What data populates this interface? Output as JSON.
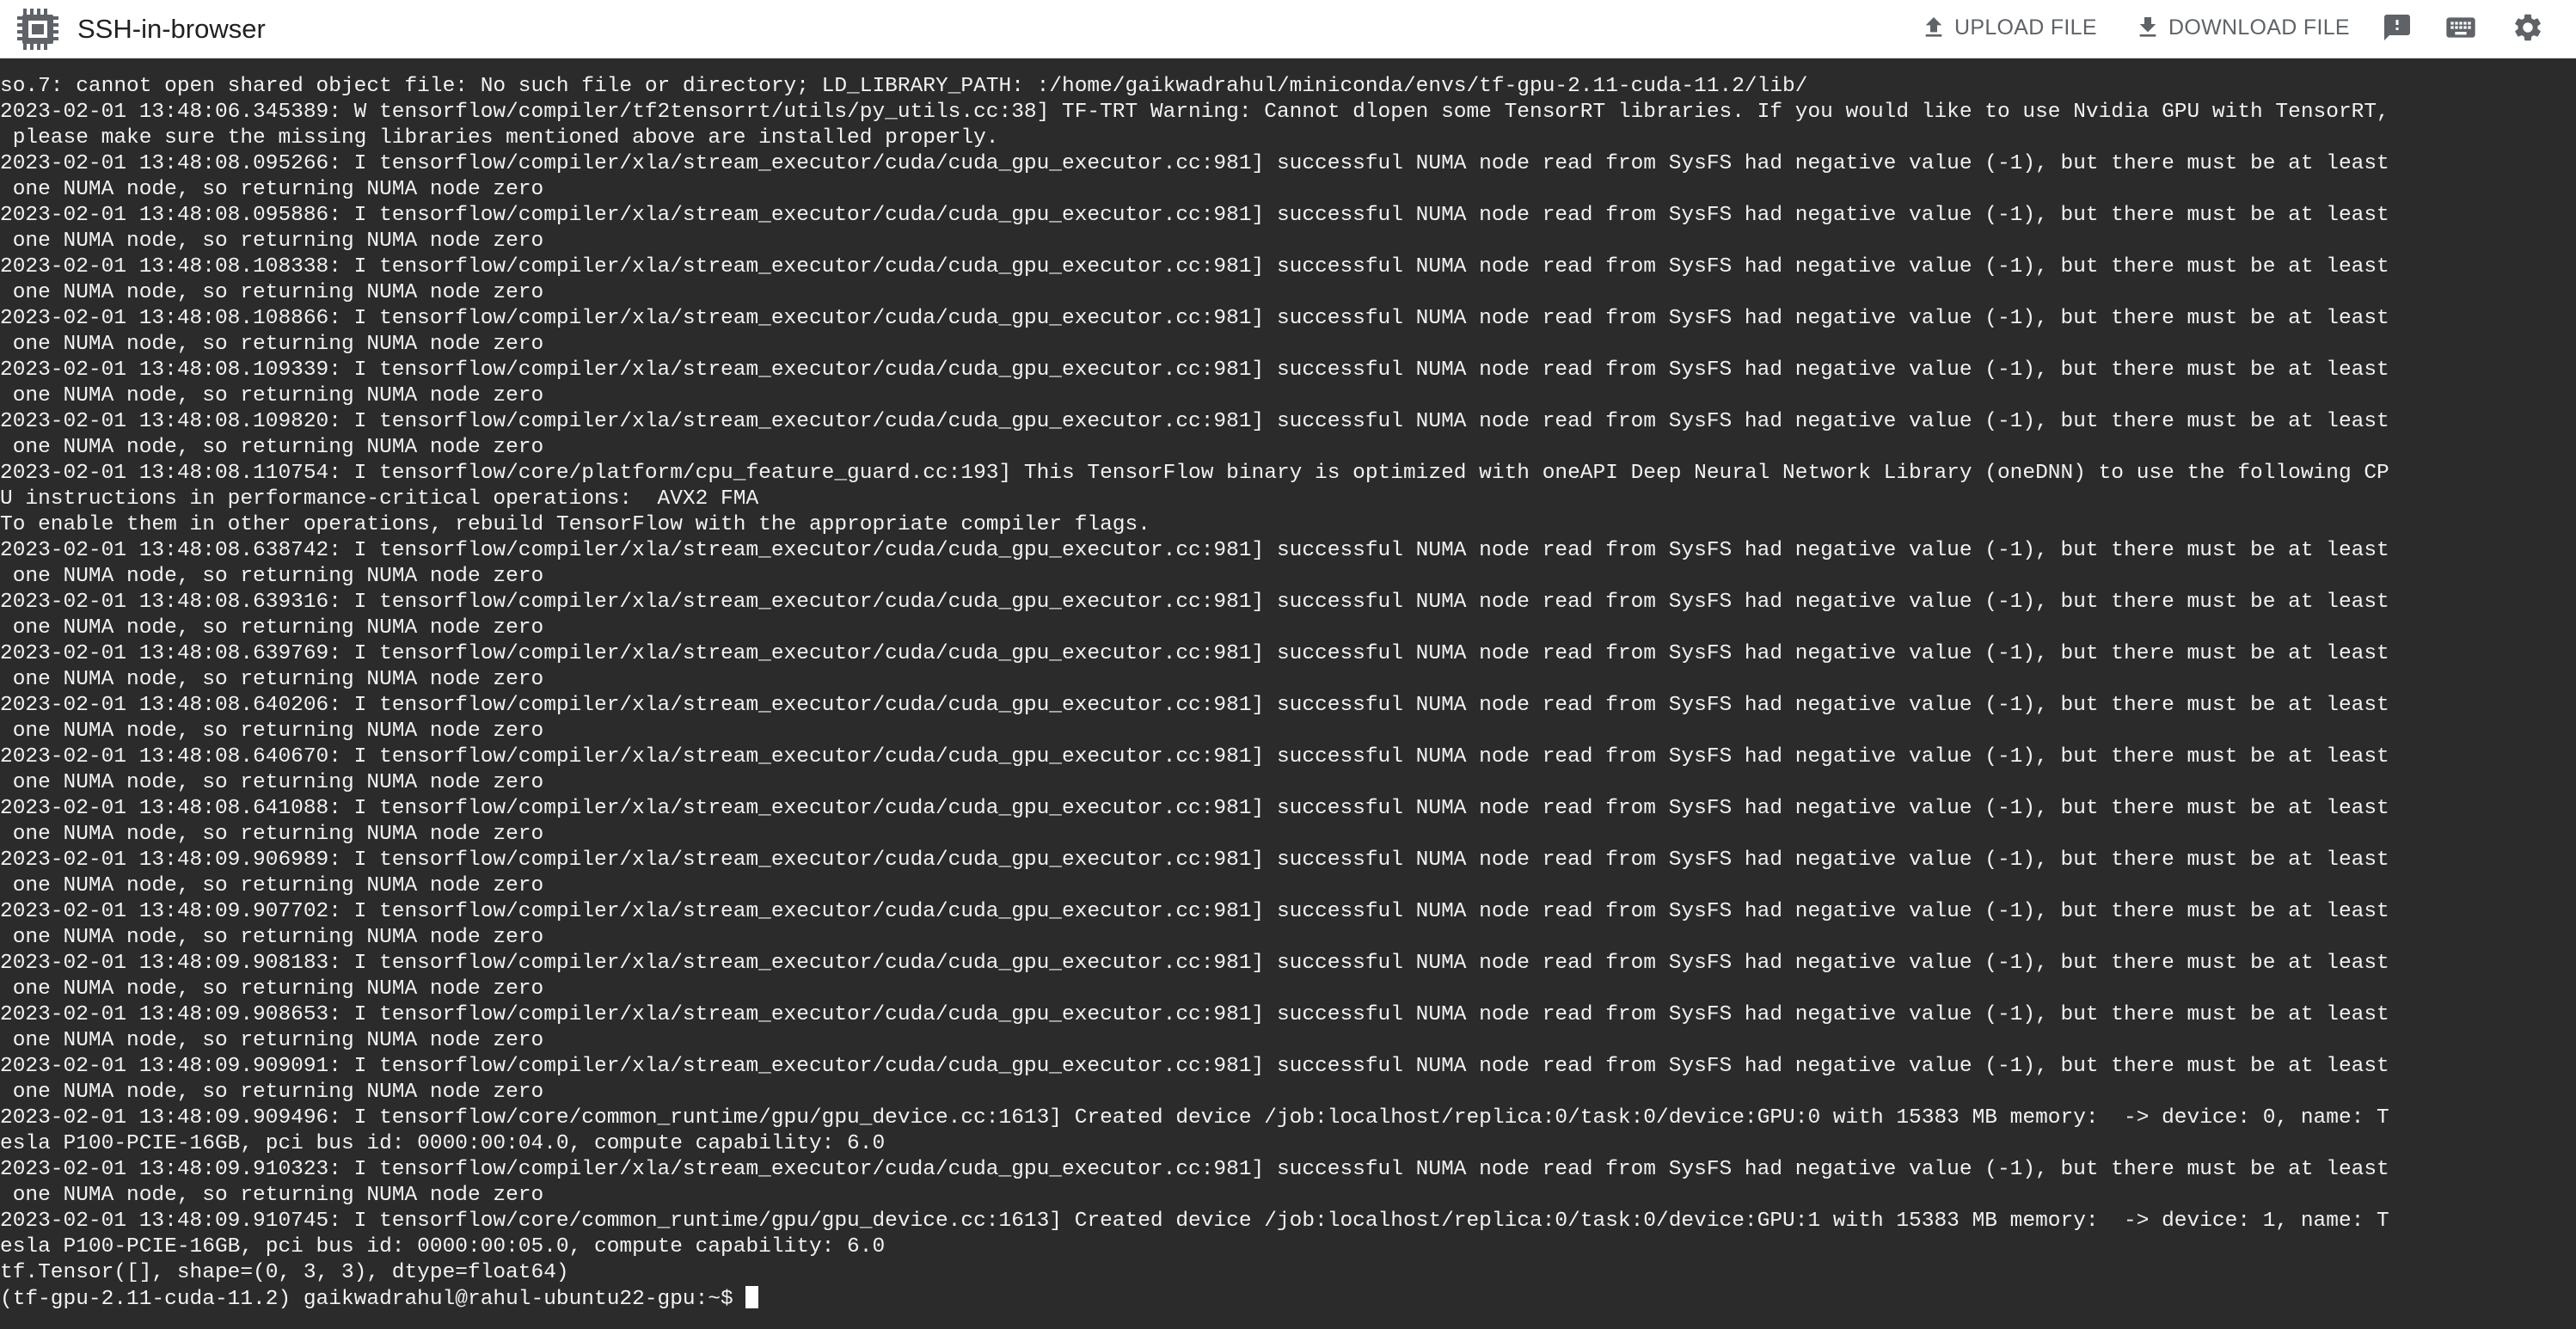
{
  "app": {
    "title": "SSH-in-browser"
  },
  "toolbar": {
    "upload_label": "UPLOAD FILE",
    "download_label": "DOWNLOAD FILE",
    "icons": [
      "upload-icon",
      "download-icon",
      "feedback-icon",
      "keyboard-icon",
      "settings-icon"
    ],
    "icon_color": "#5f6368"
  },
  "colors": {
    "terminal_bg": "#2b2b2b",
    "terminal_fg": "#f2f2f2",
    "header_bg": "#ffffff"
  },
  "terminal": {
    "lines": [
      "so.7: cannot open shared object file: No such file or directory; LD_LIBRARY_PATH: :/home/gaikwadrahul/miniconda/envs/tf-gpu-2.11-cuda-11.2/lib/",
      "2023-02-01 13:48:06.345389: W tensorflow/compiler/tf2tensorrt/utils/py_utils.cc:38] TF-TRT Warning: Cannot dlopen some TensorRT libraries. If you would like to use Nvidia GPU with TensorRT,",
      " please make sure the missing libraries mentioned above are installed properly.",
      "2023-02-01 13:48:08.095266: I tensorflow/compiler/xla/stream_executor/cuda/cuda_gpu_executor.cc:981] successful NUMA node read from SysFS had negative value (-1), but there must be at least",
      " one NUMA node, so returning NUMA node zero",
      "2023-02-01 13:48:08.095886: I tensorflow/compiler/xla/stream_executor/cuda/cuda_gpu_executor.cc:981] successful NUMA node read from SysFS had negative value (-1), but there must be at least",
      " one NUMA node, so returning NUMA node zero",
      "2023-02-01 13:48:08.108338: I tensorflow/compiler/xla/stream_executor/cuda/cuda_gpu_executor.cc:981] successful NUMA node read from SysFS had negative value (-1), but there must be at least",
      " one NUMA node, so returning NUMA node zero",
      "2023-02-01 13:48:08.108866: I tensorflow/compiler/xla/stream_executor/cuda/cuda_gpu_executor.cc:981] successful NUMA node read from SysFS had negative value (-1), but there must be at least",
      " one NUMA node, so returning NUMA node zero",
      "2023-02-01 13:48:08.109339: I tensorflow/compiler/xla/stream_executor/cuda/cuda_gpu_executor.cc:981] successful NUMA node read from SysFS had negative value (-1), but there must be at least",
      " one NUMA node, so returning NUMA node zero",
      "2023-02-01 13:48:08.109820: I tensorflow/compiler/xla/stream_executor/cuda/cuda_gpu_executor.cc:981] successful NUMA node read from SysFS had negative value (-1), but there must be at least",
      " one NUMA node, so returning NUMA node zero",
      "2023-02-01 13:48:08.110754: I tensorflow/core/platform/cpu_feature_guard.cc:193] This TensorFlow binary is optimized with oneAPI Deep Neural Network Library (oneDNN) to use the following CP",
      "U instructions in performance-critical operations:  AVX2 FMA",
      "To enable them in other operations, rebuild TensorFlow with the appropriate compiler flags.",
      "2023-02-01 13:48:08.638742: I tensorflow/compiler/xla/stream_executor/cuda/cuda_gpu_executor.cc:981] successful NUMA node read from SysFS had negative value (-1), but there must be at least",
      " one NUMA node, so returning NUMA node zero",
      "2023-02-01 13:48:08.639316: I tensorflow/compiler/xla/stream_executor/cuda/cuda_gpu_executor.cc:981] successful NUMA node read from SysFS had negative value (-1), but there must be at least",
      " one NUMA node, so returning NUMA node zero",
      "2023-02-01 13:48:08.639769: I tensorflow/compiler/xla/stream_executor/cuda/cuda_gpu_executor.cc:981] successful NUMA node read from SysFS had negative value (-1), but there must be at least",
      " one NUMA node, so returning NUMA node zero",
      "2023-02-01 13:48:08.640206: I tensorflow/compiler/xla/stream_executor/cuda/cuda_gpu_executor.cc:981] successful NUMA node read from SysFS had negative value (-1), but there must be at least",
      " one NUMA node, so returning NUMA node zero",
      "2023-02-01 13:48:08.640670: I tensorflow/compiler/xla/stream_executor/cuda/cuda_gpu_executor.cc:981] successful NUMA node read from SysFS had negative value (-1), but there must be at least",
      " one NUMA node, so returning NUMA node zero",
      "2023-02-01 13:48:08.641088: I tensorflow/compiler/xla/stream_executor/cuda/cuda_gpu_executor.cc:981] successful NUMA node read from SysFS had negative value (-1), but there must be at least",
      " one NUMA node, so returning NUMA node zero",
      "2023-02-01 13:48:09.906989: I tensorflow/compiler/xla/stream_executor/cuda/cuda_gpu_executor.cc:981] successful NUMA node read from SysFS had negative value (-1), but there must be at least",
      " one NUMA node, so returning NUMA node zero",
      "2023-02-01 13:48:09.907702: I tensorflow/compiler/xla/stream_executor/cuda/cuda_gpu_executor.cc:981] successful NUMA node read from SysFS had negative value (-1), but there must be at least",
      " one NUMA node, so returning NUMA node zero",
      "2023-02-01 13:48:09.908183: I tensorflow/compiler/xla/stream_executor/cuda/cuda_gpu_executor.cc:981] successful NUMA node read from SysFS had negative value (-1), but there must be at least",
      " one NUMA node, so returning NUMA node zero",
      "2023-02-01 13:48:09.908653: I tensorflow/compiler/xla/stream_executor/cuda/cuda_gpu_executor.cc:981] successful NUMA node read from SysFS had negative value (-1), but there must be at least",
      " one NUMA node, so returning NUMA node zero",
      "2023-02-01 13:48:09.909091: I tensorflow/compiler/xla/stream_executor/cuda/cuda_gpu_executor.cc:981] successful NUMA node read from SysFS had negative value (-1), but there must be at least",
      " one NUMA node, so returning NUMA node zero",
      "2023-02-01 13:48:09.909496: I tensorflow/core/common_runtime/gpu/gpu_device.cc:1613] Created device /job:localhost/replica:0/task:0/device:GPU:0 with 15383 MB memory:  -> device: 0, name: T",
      "esla P100-PCIE-16GB, pci bus id: 0000:00:04.0, compute capability: 6.0",
      "2023-02-01 13:48:09.910323: I tensorflow/compiler/xla/stream_executor/cuda/cuda_gpu_executor.cc:981] successful NUMA node read from SysFS had negative value (-1), but there must be at least",
      " one NUMA node, so returning NUMA node zero",
      "2023-02-01 13:48:09.910745: I tensorflow/core/common_runtime/gpu/gpu_device.cc:1613] Created device /job:localhost/replica:0/task:0/device:GPU:1 with 15383 MB memory:  -> device: 1, name: T",
      "esla P100-PCIE-16GB, pci bus id: 0000:00:05.0, compute capability: 6.0",
      "tf.Tensor([], shape=(0, 3, 3), dtype=float64)"
    ],
    "prompt": "(tf-gpu-2.11-cuda-11.2) gaikwadrahul@rahul-ubuntu22-gpu:~$ "
  }
}
